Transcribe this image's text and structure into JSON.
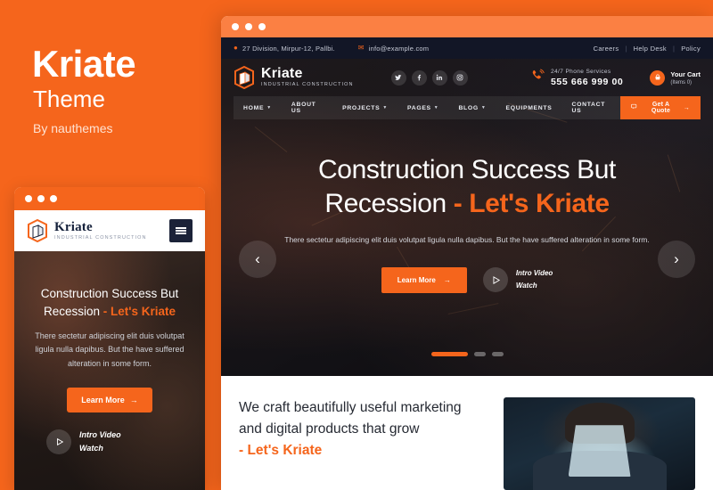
{
  "promo": {
    "title": "Kriate",
    "subtitle": "Theme",
    "byline": "By nauthemes"
  },
  "colors": {
    "brand_orange": "#f5651c",
    "window_bar_orange": "#fb8043",
    "topbar_navy": "#121626",
    "heading_dark": "#262a33"
  },
  "window": {
    "dots": [
      "dot-red",
      "dot-yellow",
      "dot-green"
    ]
  },
  "site": {
    "topbar": {
      "address": "27 Division, Mirpur-12, Pallbi.",
      "address_icon": "location-pin-icon",
      "email": "info@example.com",
      "email_icon": "envelope-icon",
      "links": [
        "Careers",
        "Help Desk",
        "Policy"
      ],
      "separator": "|"
    },
    "logo": {
      "name": "Kriate",
      "tagline": "Industrial Construction",
      "mark": "cube-building-icon"
    },
    "social": [
      {
        "name": "twitter-icon",
        "glyph": "ᴠ"
      },
      {
        "name": "facebook-icon",
        "glyph": "f"
      },
      {
        "name": "linkedin-icon",
        "glyph": "in"
      },
      {
        "name": "instagram-icon",
        "glyph": "▣"
      }
    ],
    "phone": {
      "icon": "phone-ringing-icon",
      "label": "24/7 Phone Services",
      "number": "555 666 999 00"
    },
    "cart": {
      "icon": "shopping-basket-icon",
      "label": "Your Cart",
      "sub": "(Items 0)"
    },
    "nav": [
      {
        "label": "HOME",
        "caret": true
      },
      {
        "label": "ABOUT US",
        "caret": false
      },
      {
        "label": "PROJECTS",
        "caret": true
      },
      {
        "label": "PAGES",
        "caret": true
      },
      {
        "label": "BLOG",
        "caret": true
      },
      {
        "label": "EQUIPMENTS",
        "caret": false
      },
      {
        "label": "CONTACT US",
        "caret": false
      }
    ],
    "quote_button": {
      "icon": "chat-bubble-icon",
      "label": "Get A Quote",
      "arrow": "→"
    },
    "hero": {
      "heading_line1": "Construction Success But",
      "heading_line2_plain": "Recession ",
      "heading_line2_accent": "- Let's Kriate",
      "paragraph": "There sectetur adipiscing elit duis volutpat ligula nulla dapibus. But the have suffered alteration in some form.",
      "learn_more": "Learn More",
      "learn_more_arrow": "→",
      "video_line1": "Intro Video",
      "video_line2": "Watch",
      "play_icon": "play-triangle-icon",
      "prev_icon": "chevron-left-icon",
      "next_icon": "chevron-right-icon",
      "prev_glyph": "‹",
      "next_glyph": "›",
      "slide_count": 3,
      "active_slide": 1
    },
    "lower": {
      "heading_line1": "We craft beautifully useful marketing",
      "heading_line2": "and digital products that grow",
      "heading_accent": "- Let's Kriate",
      "image_alt": "welder-wearing-helmet-photo"
    }
  },
  "mini": {
    "logo": {
      "name": "Kriate",
      "tagline": "Industrial Construction",
      "mark": "cube-building-icon"
    },
    "menu_icon": "hamburger-menu-icon",
    "hero": {
      "heading_line1": "Construction Success But",
      "heading_line2_plain": "Recession ",
      "heading_line2_accent": "- Let's Kriate",
      "paragraph": "There sectetur adipiscing elit duis volutpat ligula nulla dapibus. But the have suffered alteration in some form.",
      "learn_more": "Learn More",
      "learn_more_arrow": "→",
      "video_line1": "Intro Video",
      "video_line2": "Watch",
      "play_icon": "play-triangle-icon"
    }
  }
}
